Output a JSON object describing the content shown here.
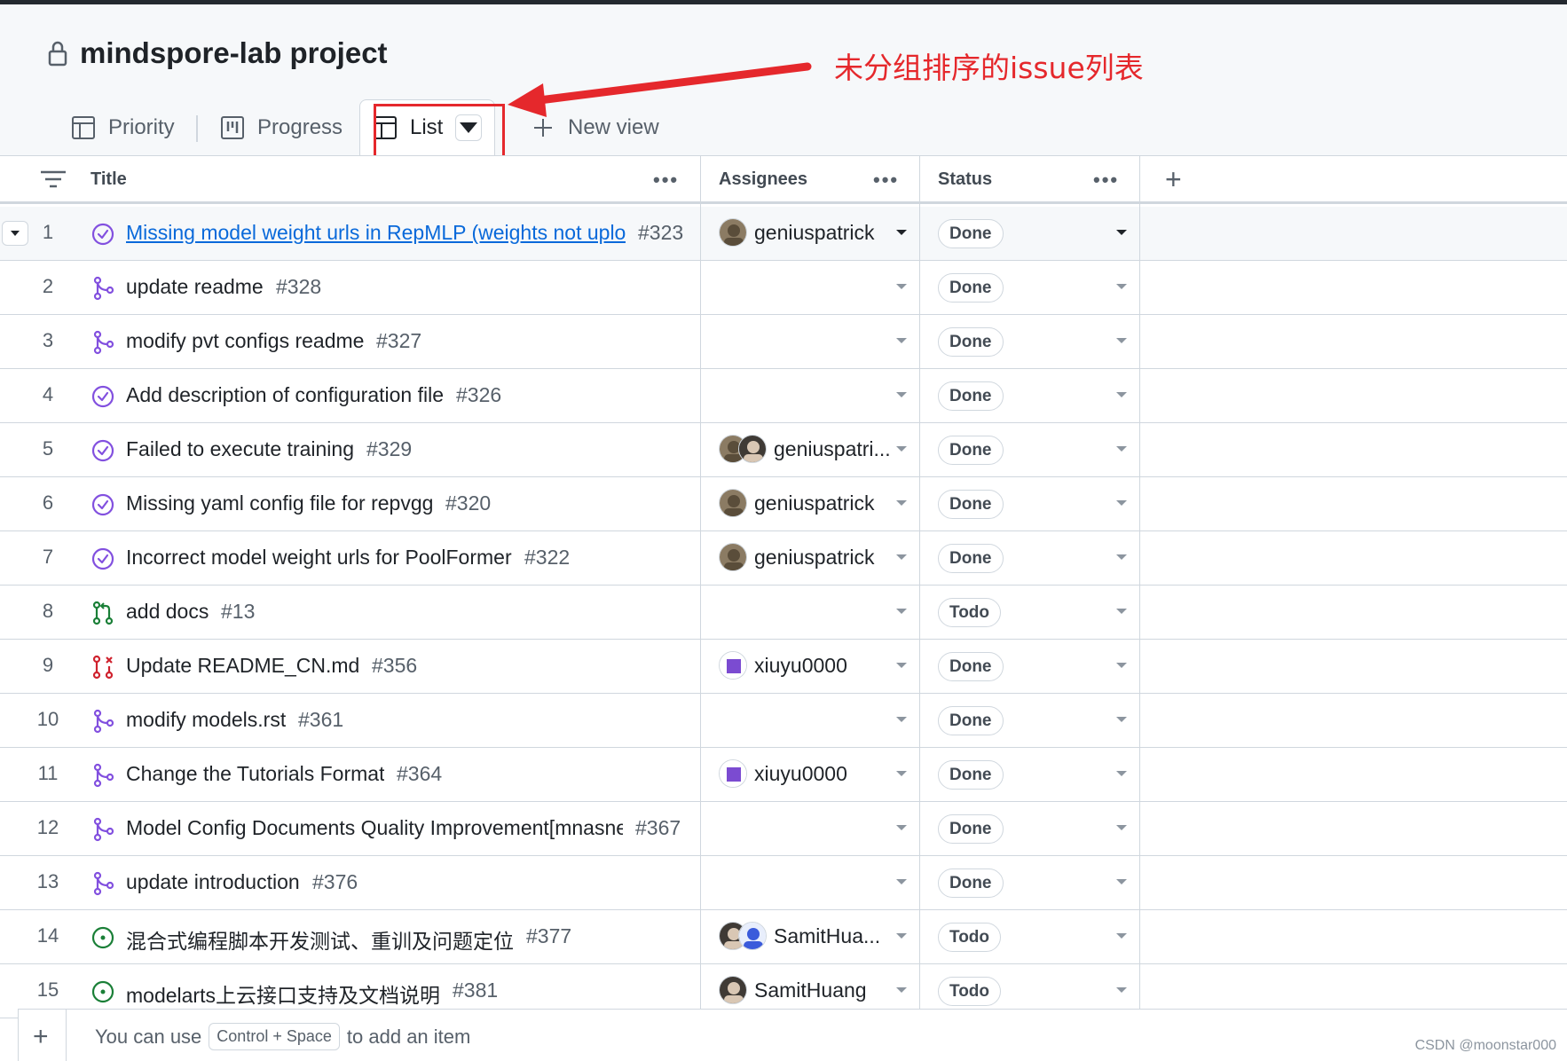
{
  "project": {
    "title": "mindspore-lab project"
  },
  "annotation": {
    "text": "未分组排序的issue列表"
  },
  "tabs": [
    {
      "label": "Priority",
      "icon": "table-icon"
    },
    {
      "label": "Progress",
      "icon": "board-icon"
    },
    {
      "label": "List",
      "icon": "table-icon",
      "active": true
    },
    {
      "label": "New view",
      "icon": "plus-icon"
    }
  ],
  "columns": {
    "title": "Title",
    "assignees": "Assignees",
    "status": "Status",
    "more": "•••",
    "add": "+"
  },
  "rows": [
    {
      "n": "1",
      "icon": "issue-closed",
      "title": "Missing model weight urls in RepMLP (weights not uplo",
      "no": "#323",
      "assignee": "geniuspatrick",
      "avatars": 1,
      "status": "Done",
      "link": true
    },
    {
      "n": "2",
      "icon": "pr-merged",
      "title": "update readme",
      "no": "#328",
      "assignee": "",
      "avatars": 0,
      "status": "Done"
    },
    {
      "n": "3",
      "icon": "pr-merged",
      "title": "modify pvt configs readme",
      "no": "#327",
      "assignee": "",
      "avatars": 0,
      "status": "Done"
    },
    {
      "n": "4",
      "icon": "issue-closed",
      "title": "Add description of configuration file",
      "no": "#326",
      "assignee": "",
      "avatars": 0,
      "status": "Done"
    },
    {
      "n": "5",
      "icon": "issue-closed",
      "title": "Failed to execute training",
      "no": "#329",
      "assignee": "geniuspatri...",
      "avatars": 2,
      "status": "Done"
    },
    {
      "n": "6",
      "icon": "issue-closed",
      "title": "Missing yaml config file for repvgg",
      "no": "#320",
      "assignee": "geniuspatrick",
      "avatars": 1,
      "status": "Done"
    },
    {
      "n": "7",
      "icon": "issue-closed",
      "title": "Incorrect model weight urls for PoolFormer",
      "no": "#322",
      "assignee": "geniuspatrick",
      "avatars": 1,
      "status": "Done"
    },
    {
      "n": "8",
      "icon": "pr-open",
      "title": "add docs",
      "no": "#13",
      "assignee": "",
      "avatars": 0,
      "status": "Todo"
    },
    {
      "n": "9",
      "icon": "pr-closed",
      "title": "Update README_CN.md",
      "no": "#356",
      "assignee": "xiuyu0000",
      "avatars": 1,
      "status": "Done"
    },
    {
      "n": "10",
      "icon": "pr-merged",
      "title": "modify models.rst",
      "no": "#361",
      "assignee": "",
      "avatars": 0,
      "status": "Done"
    },
    {
      "n": "11",
      "icon": "pr-merged",
      "title": "Change the Tutorials Format",
      "no": "#364",
      "assignee": "xiuyu0000",
      "avatars": 1,
      "status": "Done"
    },
    {
      "n": "12",
      "icon": "pr-merged",
      "title": "Model Config Documents Quality Improvement[mnasne",
      "no": "#367",
      "assignee": "",
      "avatars": 0,
      "status": "Done"
    },
    {
      "n": "13",
      "icon": "pr-merged",
      "title": "update introduction",
      "no": "#376",
      "assignee": "",
      "avatars": 0,
      "status": "Done"
    },
    {
      "n": "14",
      "icon": "issue-open",
      "title": "混合式编程脚本开发测试、重训及问题定位",
      "no": "#377",
      "assignee": "SamitHua...",
      "avatars": 2,
      "status": "Todo"
    },
    {
      "n": "15",
      "icon": "issue-open",
      "title": "modelarts上云接口支持及文档说明",
      "no": "#381",
      "assignee": "SamitHuang",
      "avatars": 1,
      "status": "Todo"
    }
  ],
  "footer": {
    "plus": "+",
    "pre": "You can use",
    "key1": "Control",
    "plus_key": "+",
    "key2": "Space",
    "post": "to add an item"
  },
  "watermark": "CSDN @moonstar000",
  "colors": {
    "done_purple": "#8250df",
    "open_green": "#1a7f37",
    "closed_red": "#cf222e",
    "link_blue": "#0969da",
    "annotation_red": "#e5282c"
  }
}
